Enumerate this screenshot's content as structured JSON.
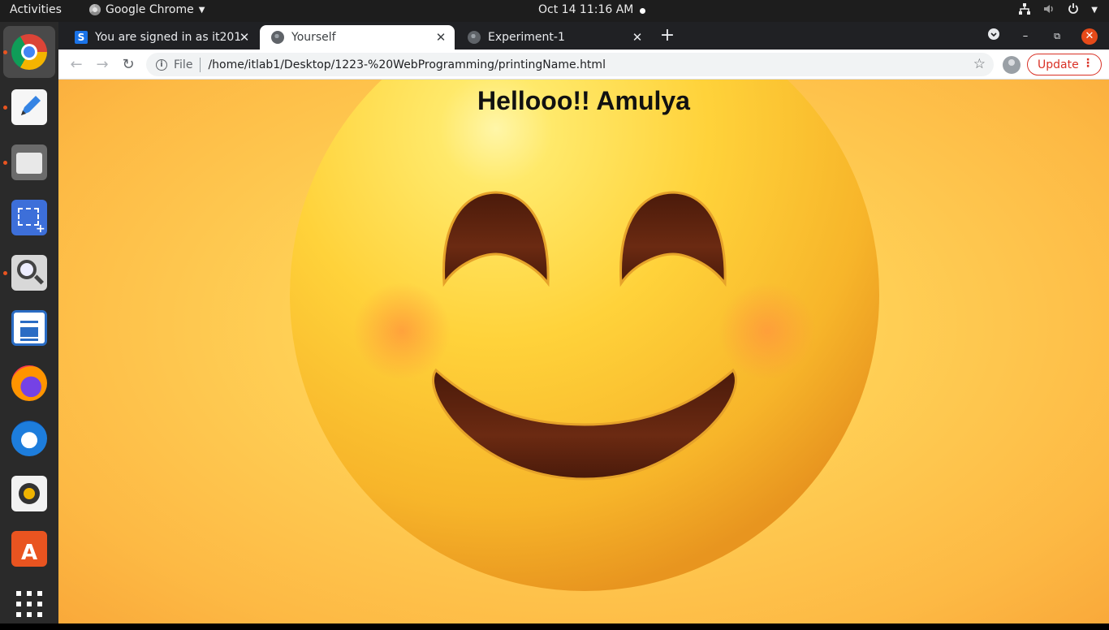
{
  "topbar": {
    "activities": "Activities",
    "app_name": "Google Chrome",
    "clock": "Oct 14  11:16 AM"
  },
  "dock": {
    "items": [
      "chrome",
      "text-editor",
      "files",
      "screenshot",
      "image-viewer",
      "libreoffice-writer",
      "firefox",
      "thunderbird",
      "rhythmbox",
      "software-center",
      "show-applications"
    ]
  },
  "browser": {
    "tabs": [
      {
        "title": "You are signed in as it201",
        "favicon": "S",
        "active": false
      },
      {
        "title": "Yourself",
        "active": true
      },
      {
        "title": "Experiment-1",
        "active": false
      }
    ],
    "address": {
      "scheme_label": "File",
      "url": "/home/itlab1/Desktop/1223-%20WebProgramming/printingName.html"
    },
    "update_label": "Update"
  },
  "page": {
    "heading": "Hellooo!! Amulya"
  },
  "colors": {
    "update_red": "#d93025",
    "emoji_yellow": "#ffd43b",
    "mouth_brown": "#5a1f0c"
  }
}
